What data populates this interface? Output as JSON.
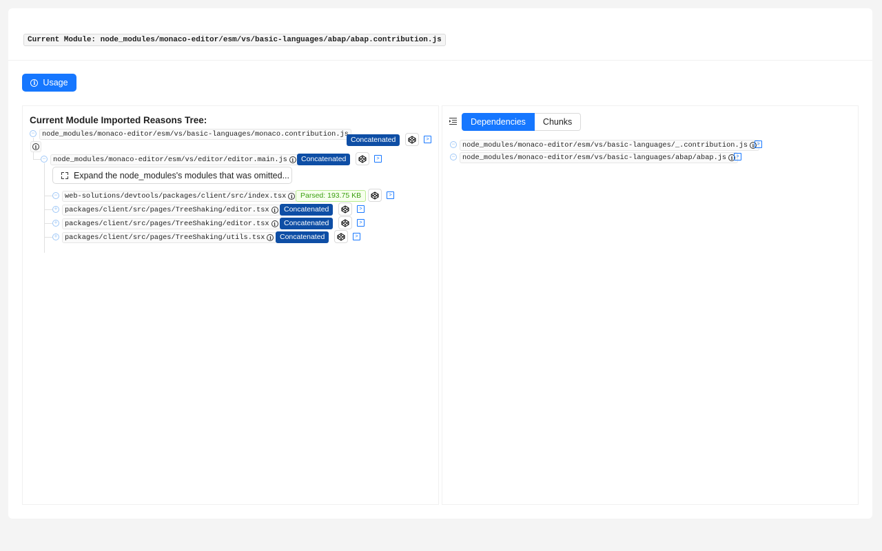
{
  "header": {
    "current_module_label": "Current Module: node_modules/monaco-editor/esm/vs/basic-languages/abap/abap.contribution.js"
  },
  "usage_button": {
    "label": "Usage",
    "icon": "info-icon"
  },
  "left_panel": {
    "title": "Current Module Imported Reasons Tree:",
    "root": {
      "path": "node_modules/monaco-editor/esm/vs/basic-languages/monaco.contribution.js",
      "tag": "Concatenated"
    },
    "child": {
      "path": "node_modules/monaco-editor/esm/vs/editor/editor.main.js",
      "tag": "Concatenated"
    },
    "expand_label": "Expand the node_modules's modules that was omitted...",
    "items": [
      {
        "path": "web-solutions/devtools/packages/client/src/index.tsx",
        "tag": "Parsed: 193.75 KB"
      },
      {
        "path": "packages/client/src/pages/TreeShaking/editor.tsx",
        "tag": "Concatenated"
      },
      {
        "path": "packages/client/src/pages/TreeShaking/editor.tsx",
        "tag": "Concatenated"
      },
      {
        "path": "packages/client/src/pages/TreeShaking/utils.tsx",
        "tag": "Concatenated"
      }
    ]
  },
  "right_panel": {
    "tabs": [
      "Dependencies",
      "Chunks"
    ],
    "active_tab": "Dependencies",
    "items": [
      {
        "path": "node_modules/monaco-editor/esm/vs/basic-languages/_.contribution.js"
      },
      {
        "path": "node_modules/monaco-editor/esm/vs/basic-languages/abap/abap.js"
      }
    ]
  },
  "colors": {
    "primary": "#1677ff",
    "concatenated_tag": "#0e4ea5",
    "parsed_tag_text": "#389e0d",
    "parsed_tag_bg": "#f6ffed"
  }
}
